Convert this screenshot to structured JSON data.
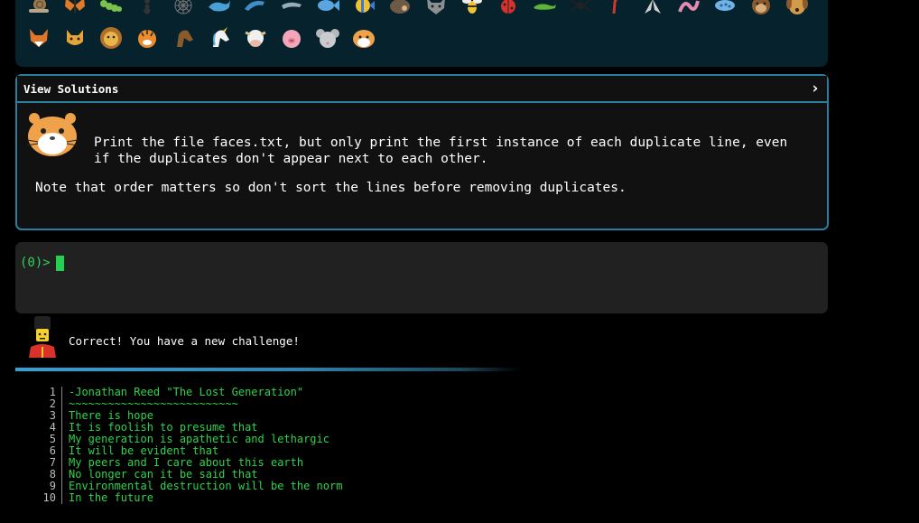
{
  "emoji_grid": {
    "row1": [
      "snail",
      "butterfly",
      "caterpillar",
      "ant",
      "spider-web",
      "whale",
      "dolphin",
      "dolphin-2",
      "fish",
      "tropical-fish",
      "hedgehog",
      "wolf",
      "bee",
      "ladybug",
      "lizard",
      "spider",
      "scorpion",
      "fly",
      "worm",
      "microbe",
      "monkey",
      "dog"
    ],
    "row2": [
      "fox",
      "cat",
      "lion",
      "tiger",
      "horse",
      "unicorn",
      "cow",
      "pig",
      "mouse",
      "hamster"
    ]
  },
  "solutions": {
    "title": "View Solutions",
    "chevron": "›",
    "instruction": "Print the file faces.txt, but only print the first instance of each duplicate line, even if the duplicates don't appear next to each other.",
    "note": "Note that order matters so don't sort the lines before removing duplicates."
  },
  "terminal": {
    "prompt": "(0)>"
  },
  "feedback": {
    "message": "Correct! You have a new challenge!"
  },
  "progress": {
    "fraction": 0.62
  },
  "file_lines": [
    {
      "n": "1",
      "text": "-Jonathan Reed \"The Lost Generation\""
    },
    {
      "n": "2",
      "text": "~~~~~~~~~~~~~~~~~~~~~~~~~~"
    },
    {
      "n": "3",
      "text": "There is hope"
    },
    {
      "n": "4",
      "text": "It is foolish to presume that"
    },
    {
      "n": "5",
      "text": "My generation is apathetic and lethargic"
    },
    {
      "n": "6",
      "text": "It will be evident that"
    },
    {
      "n": "7",
      "text": "My peers and I care about this earth"
    },
    {
      "n": "8",
      "text": "No longer can it be said that"
    },
    {
      "n": "9",
      "text": "Environmental destruction will be the norm"
    },
    {
      "n": "10",
      "text": "In the future"
    }
  ],
  "colors": {
    "panel_bg": "#05222d",
    "border": "#2a7f9c",
    "terminal_bg": "#212121",
    "green": "#30d24d"
  }
}
